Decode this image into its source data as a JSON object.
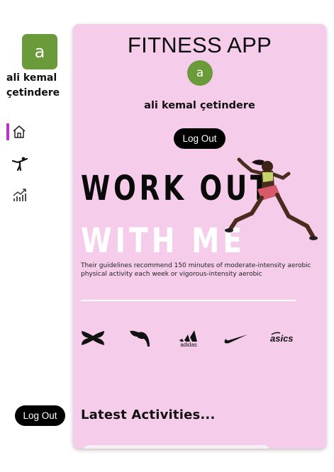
{
  "sidebar": {
    "avatar_letter": "a",
    "user_name": "ali kemal çetindere",
    "nav": [
      {
        "name": "home",
        "icon": "home-icon",
        "active": true
      },
      {
        "name": "workouts",
        "icon": "stretching-person-icon",
        "active": false
      },
      {
        "name": "stats",
        "icon": "chart-growth-icon",
        "active": false
      }
    ],
    "logout_label": "Log Out",
    "active_color": "#c02cd8"
  },
  "main": {
    "app_title": "FITNESS APP",
    "avatar_letter": "a",
    "user_name": "ali kemal çetindere",
    "logout_label": "Log Out",
    "hero": {
      "line1": "WORK OUT",
      "line2": "WITH ME",
      "description": "Their guidelines recommend 150 minutes of moderate-intensity aerobic physical activity each week or vigorous-intensity aerobic"
    },
    "brands": [
      {
        "name": "Under Armour",
        "icon": "under-armour-logo"
      },
      {
        "name": "Puma",
        "icon": "puma-logo"
      },
      {
        "name": "adidas",
        "icon": "adidas-logo"
      },
      {
        "name": "Nike",
        "icon": "nike-logo"
      },
      {
        "name": "asics",
        "icon": "asics-logo"
      }
    ],
    "latest_title": "Latest Activities..."
  },
  "colors": {
    "card_background": "#f5cdea",
    "avatar": "#6a9a3a",
    "button": "#000000"
  }
}
